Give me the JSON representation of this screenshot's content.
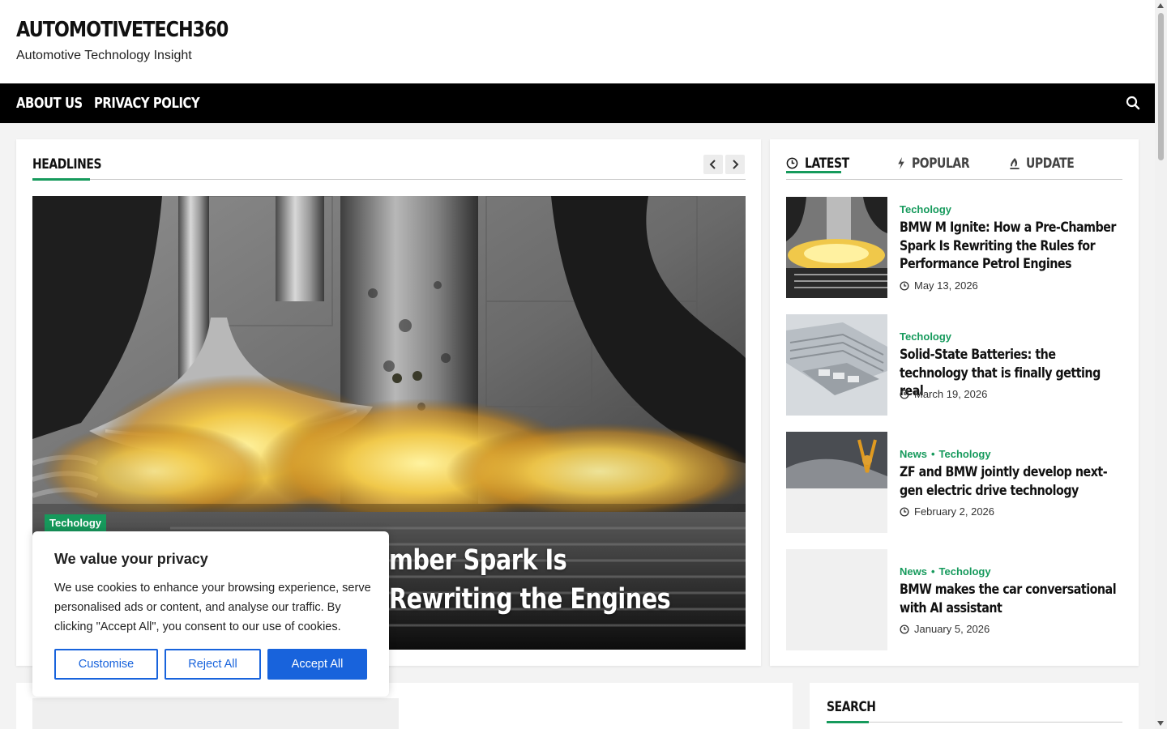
{
  "site": {
    "title": "AUTOMOTIVETECH360",
    "tagline": "Automotive Technology Insight"
  },
  "nav": {
    "items": [
      "ABOUT US",
      "PRIVACY POLICY"
    ],
    "search_icon": "search-icon"
  },
  "headlines": {
    "title": "HEADLINES",
    "prev_icon": "chevron-left-icon",
    "next_icon": "chevron-right-icon",
    "hero": {
      "category": "Techology",
      "title_visible": "mber Spark Is Rewriting the Engines"
    }
  },
  "tabs": [
    {
      "label": "LATEST",
      "icon": "clock-icon",
      "active": true
    },
    {
      "label": "POPULAR",
      "icon": "bolt-icon",
      "active": false
    },
    {
      "label": "UPDATE",
      "icon": "flame-icon",
      "active": false
    }
  ],
  "posts": [
    {
      "categories": [
        "Techology"
      ],
      "title": "BMW M Ignite: How a Pre-Chamber Spark Is Rewriting the Rules for Performance Petrol Engines",
      "date": "May 13, 2026"
    },
    {
      "categories": [
        "Techology"
      ],
      "title": "Solid-State Batteries: the technology that is finally getting real",
      "date": "March 19, 2026"
    },
    {
      "categories": [
        "News",
        "Techology"
      ],
      "title": "ZF and BMW jointly develop next-gen electric drive technology",
      "date": "February 2, 2026"
    },
    {
      "categories": [
        "News",
        "Techology"
      ],
      "title": "BMW makes the car conversational with AI assistant",
      "date": "January 5, 2026"
    }
  ],
  "sidebar": {
    "search_title": "SEARCH"
  },
  "cookie": {
    "title": "We value your privacy",
    "text": "We use cookies to enhance your browsing experience, serve personalised ads or content, and analyse our traffic. By clicking \"Accept All\", you consent to our use of cookies.",
    "customise": "Customise",
    "reject": "Reject All",
    "accept": "Accept All"
  },
  "colors": {
    "accent": "#169a5c",
    "nav_bg": "#000000",
    "cookie_button": "#1863dc"
  }
}
